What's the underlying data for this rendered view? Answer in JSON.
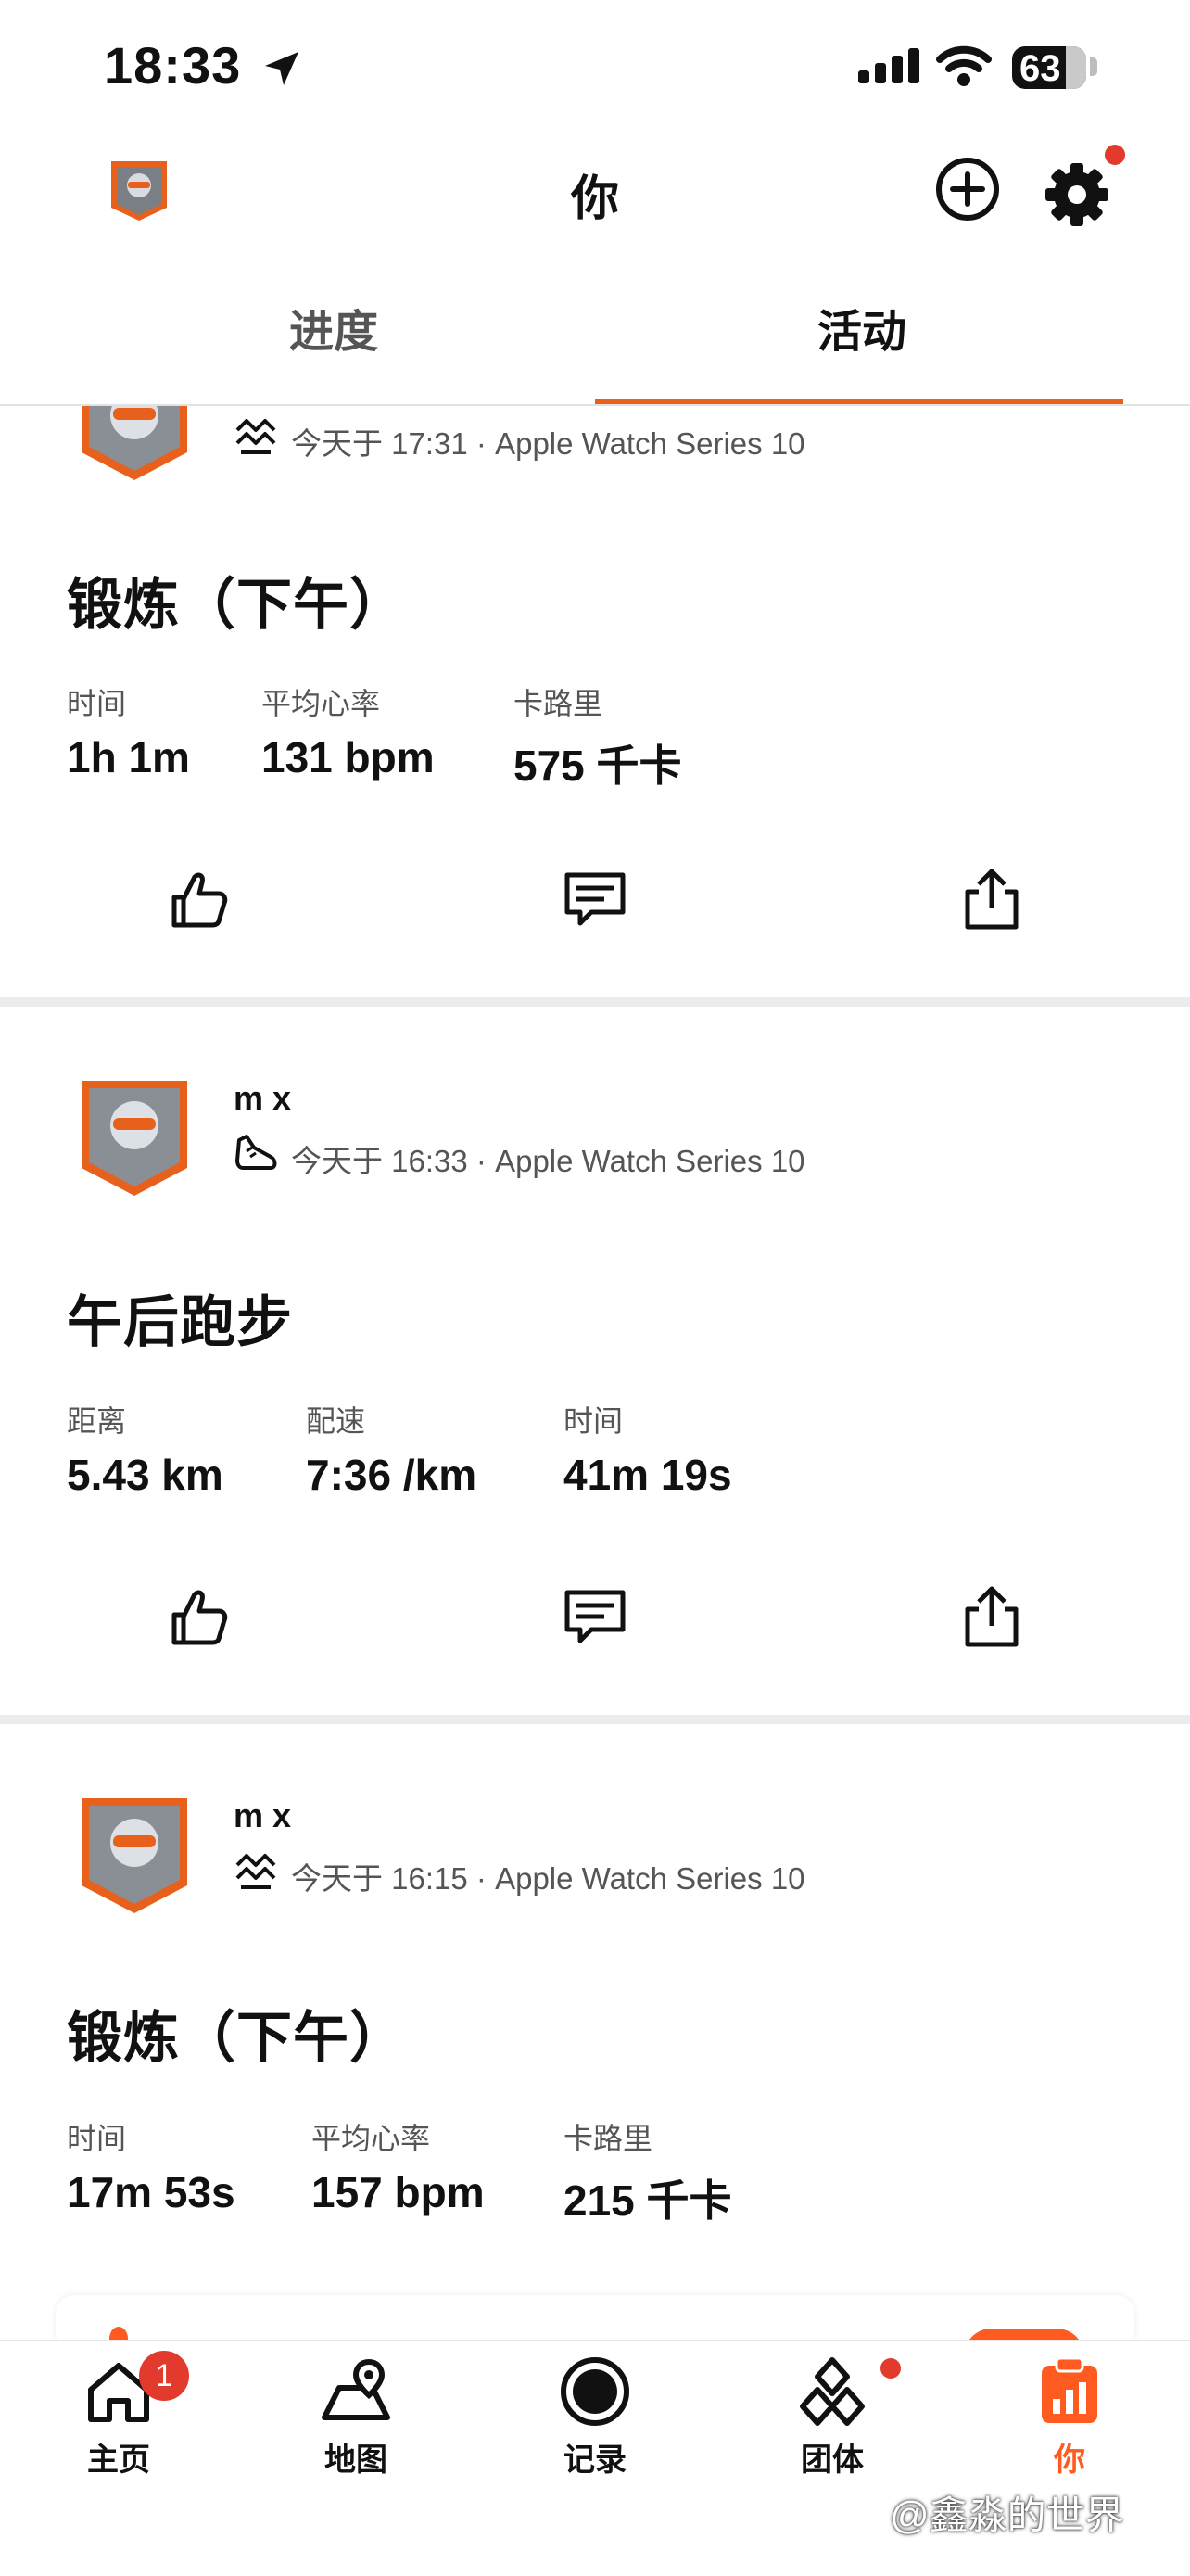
{
  "status_bar": {
    "time": "18:33",
    "battery": "63"
  },
  "header": {
    "title": "你"
  },
  "tabs": [
    {
      "label": "进度"
    },
    {
      "label": "活动"
    }
  ],
  "feed": [
    {
      "user": "",
      "meta": "今天于 17:31 · Apple Watch Series 10",
      "sport_icon": "workout-icon",
      "title": "锻炼（下午）",
      "stats": [
        {
          "label": "时间",
          "value": "1h 1m"
        },
        {
          "label": "平均心率",
          "value": "131 bpm"
        },
        {
          "label": "卡路里",
          "value": "575 千卡"
        }
      ]
    },
    {
      "user": "m x",
      "meta": "今天于 16:33 · Apple Watch Series 10",
      "sport_icon": "running-shoe-icon",
      "title": "午后跑步",
      "stats": [
        {
          "label": "距离",
          "value": "5.43 km"
        },
        {
          "label": "配速",
          "value": "7:36 /km"
        },
        {
          "label": "时间",
          "value": "41m 19s"
        }
      ]
    },
    {
      "user": "m x",
      "meta": "今天于 16:15 · Apple Watch Series 10",
      "sport_icon": "workout-icon",
      "title": "锻炼（下午）",
      "stats": [
        {
          "label": "时间",
          "value": "17m 53s"
        },
        {
          "label": "平均心率",
          "value": "157 bpm"
        },
        {
          "label": "卡路里",
          "value": "215 千卡"
        }
      ]
    }
  ],
  "bottom_nav": [
    {
      "label": "主页",
      "icon": "home-icon",
      "badge": "1"
    },
    {
      "label": "地图",
      "icon": "map-icon"
    },
    {
      "label": "记录",
      "icon": "record-icon"
    },
    {
      "label": "团体",
      "icon": "groups-icon"
    },
    {
      "label": "你",
      "icon": "you-icon",
      "active": true
    }
  ],
  "watermark": "@鑫淼的世界",
  "colors": {
    "accent": "#ff5a1f",
    "tab_underline": "#e8611c",
    "notification": "#e23b2e",
    "text": "#111111",
    "muted": "#555555"
  }
}
